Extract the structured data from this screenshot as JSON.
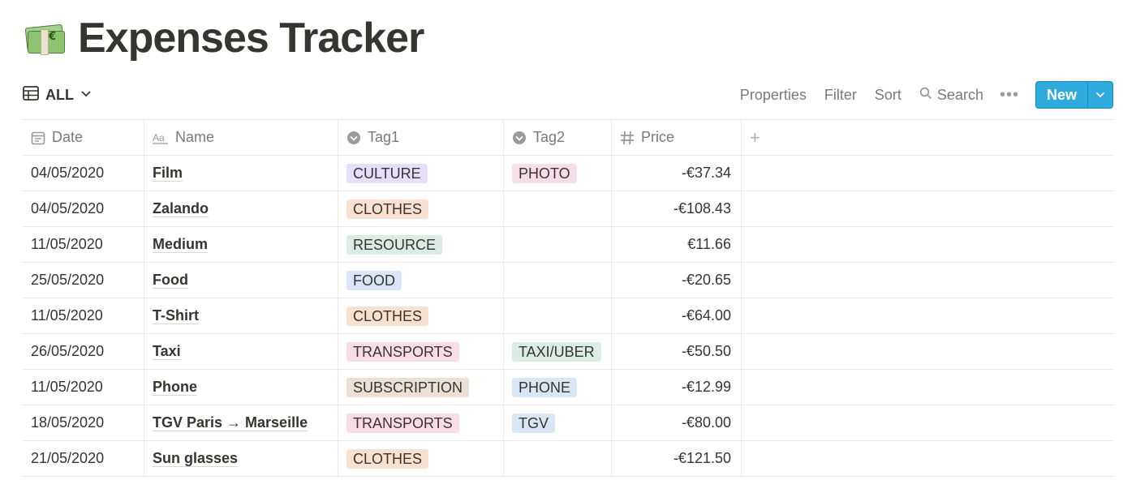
{
  "page": {
    "title": "Expenses Tracker",
    "title_icon": "money-banknote-icon",
    "title_icon_symbol": "€"
  },
  "toolbar": {
    "view_label": "ALL",
    "properties_label": "Properties",
    "filter_label": "Filter",
    "sort_label": "Sort",
    "search_label": "Search",
    "more_label": "•••",
    "new_label": "New"
  },
  "table": {
    "columns": {
      "date": "Date",
      "name": "Name",
      "tag1": "Tag1",
      "tag2": "Tag2",
      "price": "Price",
      "add": "+"
    },
    "rows": [
      {
        "date": "04/05/2020",
        "name": "Film",
        "tag1": "CULTURE",
        "tag2": "PHOTO",
        "price": "-€37.34"
      },
      {
        "date": "04/05/2020",
        "name": "Zalando",
        "tag1": "CLOTHES",
        "tag2": "",
        "price": "-€108.43"
      },
      {
        "date": "11/05/2020",
        "name": "Medium",
        "tag1": "RESOURCE",
        "tag2": "",
        "price": "€11.66"
      },
      {
        "date": "25/05/2020",
        "name": "Food",
        "tag1": "FOOD",
        "tag2": "",
        "price": "-€20.65"
      },
      {
        "date": "11/05/2020",
        "name": "T-Shirt",
        "tag1": "CLOTHES",
        "tag2": "",
        "price": "-€64.00"
      },
      {
        "date": "26/05/2020",
        "name": "Taxi",
        "tag1": "TRANSPORTS",
        "tag2": "TAXI/UBER",
        "price": "-€50.50"
      },
      {
        "date": "11/05/2020",
        "name": "Phone",
        "tag1": "SUBSCRIPTION",
        "tag2": "PHONE",
        "price": "-€12.99"
      },
      {
        "date": "18/05/2020",
        "name": "TGV Paris → Marseille",
        "tag1": "TRANSPORTS",
        "tag2": "TGV",
        "price": "-€80.00"
      },
      {
        "date": "21/05/2020",
        "name": "Sun glasses",
        "tag1": "CLOTHES",
        "tag2": "",
        "price": "-€121.50"
      }
    ]
  },
  "tag_colors": {
    "CULTURE": "#e6defa",
    "PHOTO": "#f8deea",
    "CLOTHES": "#fae0d0",
    "RESOURCE": "#dbece5",
    "FOOD": "#d8e6f6",
    "TRANSPORTS": "#fadbe8",
    "TAXI/UBER": "#dbece5",
    "SUBSCRIPTION": "#ebdfd6",
    "PHONE": "#d8e6f6",
    "TGV": "#d8e6f6"
  },
  "colors": {
    "accent": "#2eaadc",
    "text": "#37352f",
    "muted": "#7b7a76",
    "border": "#e9e9e7"
  }
}
